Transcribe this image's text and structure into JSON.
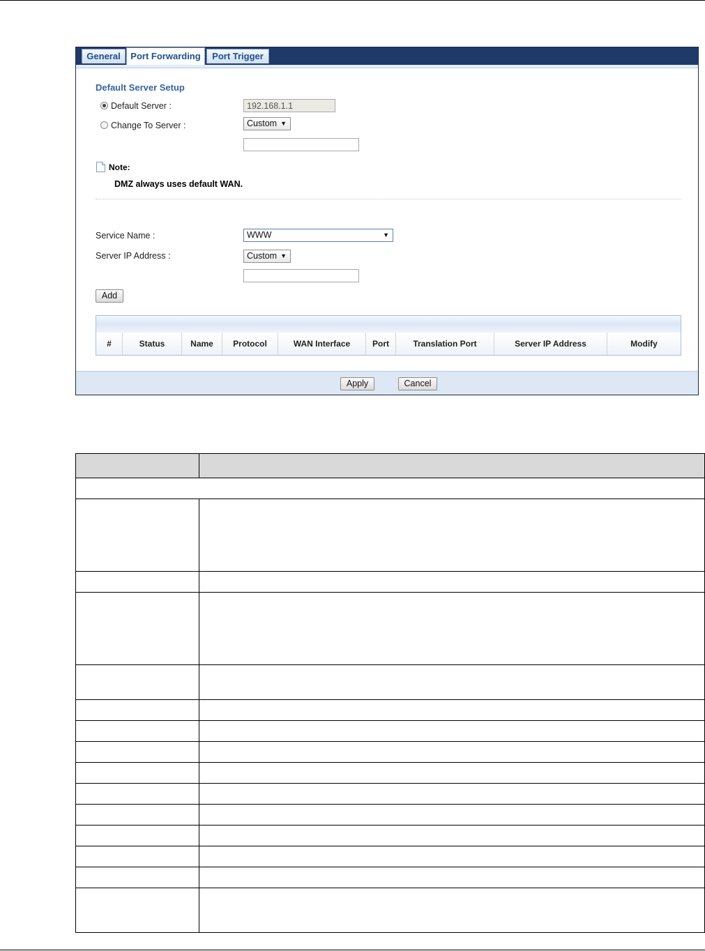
{
  "tabs": [
    {
      "label": "General",
      "active": false
    },
    {
      "label": "Port Forwarding",
      "active": true
    },
    {
      "label": "Port Trigger",
      "active": false
    }
  ],
  "default_server_setup": {
    "title": "Default Server Setup",
    "default_server_label": "Default Server :",
    "default_server_value": "192.168.1.1",
    "default_server_selected": true,
    "change_to_server_label": "Change To Server :",
    "change_to_server_select": "Custom",
    "change_to_server_ip": ""
  },
  "note": {
    "title": "Note:",
    "text": "DMZ always uses default WAN."
  },
  "port_forwarding_form": {
    "service_name_label": "Service Name :",
    "service_name_value": "WWW",
    "server_ip_label": "Server IP Address :",
    "server_ip_select": "Custom",
    "server_ip_value": "",
    "add_button": "Add"
  },
  "rules_table": {
    "columns": [
      "#",
      "Status",
      "Name",
      "Protocol",
      "WAN Interface",
      "Port",
      "Translation Port",
      "Server IP Address",
      "Modify"
    ],
    "rows": []
  },
  "footer": {
    "apply_button": "Apply",
    "cancel_button": "Cancel"
  },
  "document_table": {
    "header_shaded": true,
    "row_count": 17
  },
  "colors": {
    "tab_bar": "#1f3a68",
    "tab_text": "#1d4f8f",
    "section_title": "#35649e",
    "footer_bar": "#dde8f4",
    "doc_header": "#d9d9d9"
  }
}
